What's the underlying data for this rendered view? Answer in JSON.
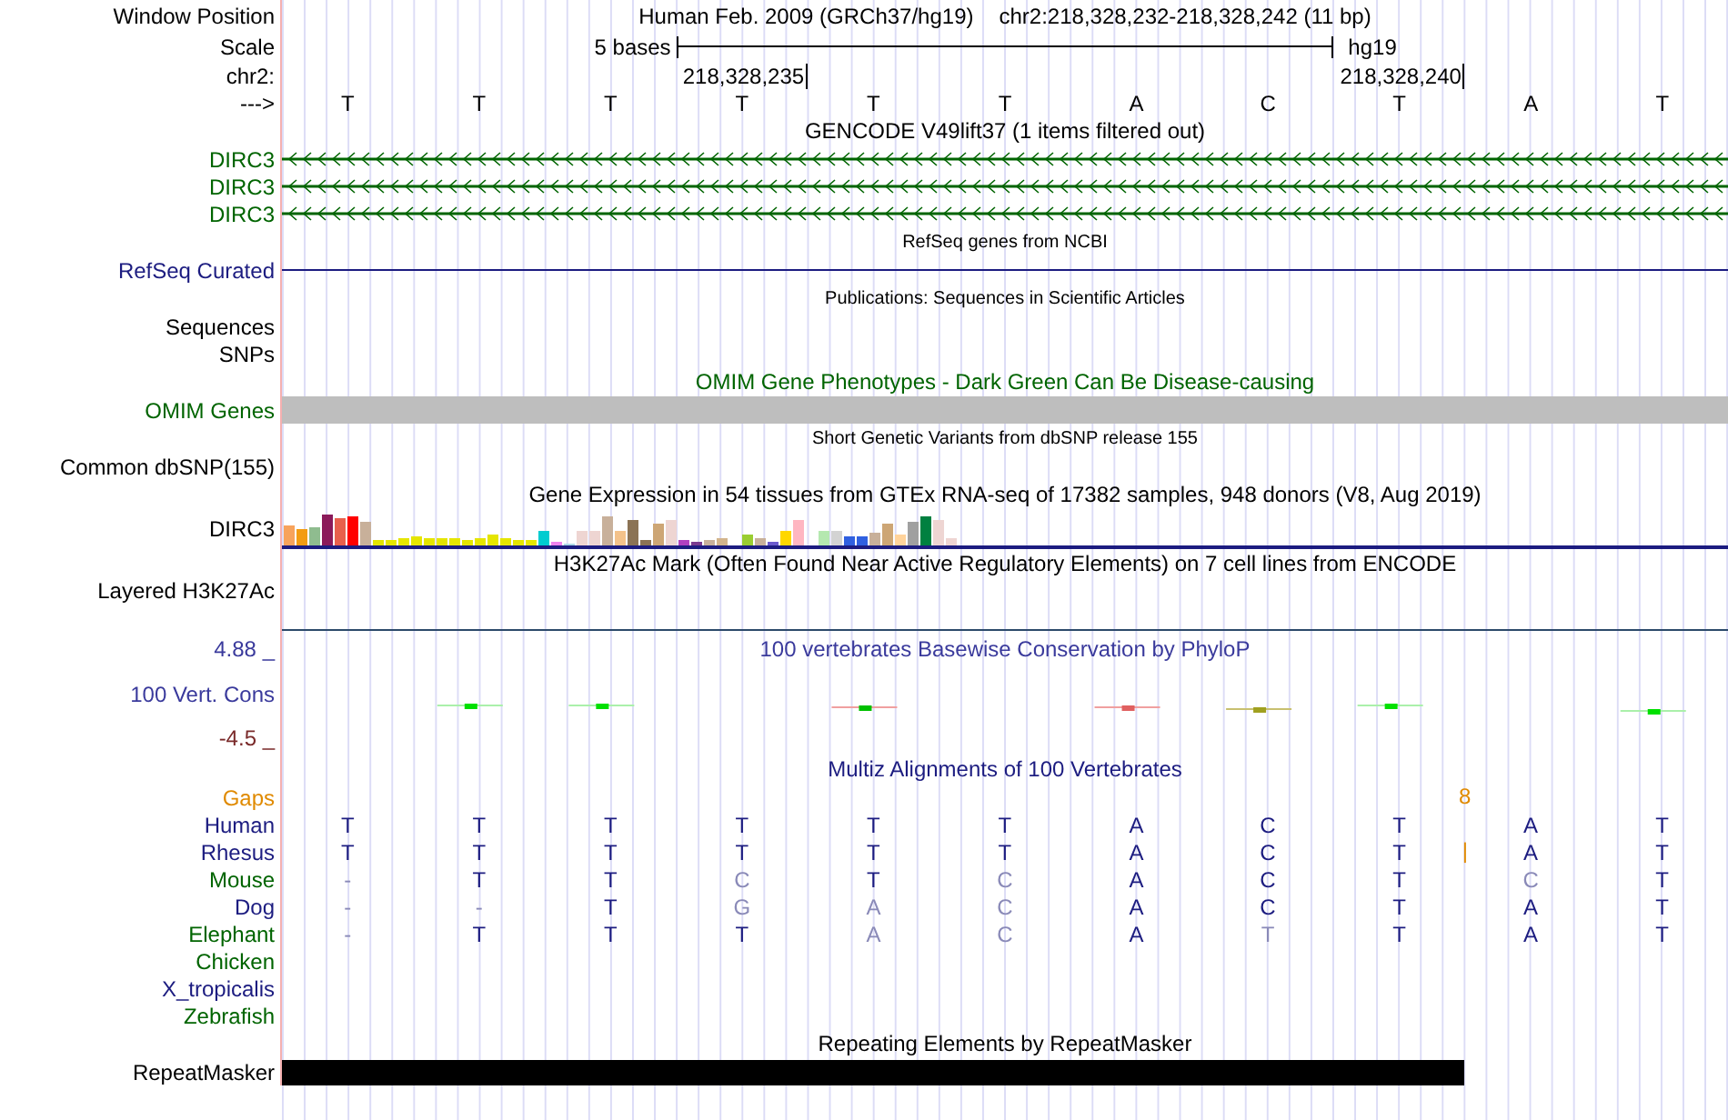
{
  "header": {
    "label": "Window Position",
    "assembly": "Human Feb. 2009 (GRCh37/hg19)",
    "position": "chr2:218,328,232-218,328,242 (11 bp)"
  },
  "scale": {
    "label": "Scale",
    "ruler_label": "5 bases",
    "assembly_label": "hg19"
  },
  "coordinates": {
    "label": "chr2:",
    "ticks": [
      "218,328,235",
      "218,328,240"
    ]
  },
  "sequence": {
    "label": "--->",
    "bases": [
      "T",
      "T",
      "T",
      "T",
      "T",
      "T",
      "A",
      "C",
      "T",
      "A",
      "T"
    ]
  },
  "tracks": [
    {
      "kind": "title",
      "text": "GENCODE V49lift37 (1 items filtered out)",
      "color": "#000000"
    },
    {
      "kind": "gene",
      "label": "DIRC3",
      "color": "#006400"
    },
    {
      "kind": "gene",
      "label": "DIRC3",
      "color": "#006400"
    },
    {
      "kind": "gene",
      "label": "DIRC3",
      "color": "#006400"
    },
    {
      "kind": "subtitle",
      "text": "RefSeq genes from NCBI",
      "color": "#000000"
    },
    {
      "kind": "line",
      "label": "RefSeq Curated",
      "color": "#1c1c80"
    },
    {
      "kind": "subtitle",
      "text": "Publications: Sequences in Scientific Articles",
      "color": "#000000"
    },
    {
      "kind": "empty",
      "label": "Sequences",
      "color": "#000000"
    },
    {
      "kind": "empty",
      "label": "SNPs",
      "color": "#000000"
    },
    {
      "kind": "title",
      "text": "OMIM Gene Phenotypes - Dark Green Can Be Disease-causing",
      "color": "#006400"
    },
    {
      "kind": "bar",
      "label": "OMIM Genes",
      "color": "#006400"
    },
    {
      "kind": "subtitle",
      "text": "Short Genetic Variants from dbSNP release 155",
      "color": "#000000"
    },
    {
      "kind": "empty",
      "label": "Common dbSNP(155)",
      "color": "#000000"
    },
    {
      "kind": "title",
      "text": "Gene Expression in 54 tissues from GTEx RNA-seq of 17382 samples, 948 donors (V8, Aug 2019)",
      "color": "#000000"
    },
    {
      "kind": "expression",
      "label": "DIRC3",
      "color": "#000000"
    },
    {
      "kind": "title",
      "text": "H3K27Ac Mark (Often Found Near Active Regulatory Elements) on 7 cell lines from ENCODE",
      "color": "#000000"
    },
    {
      "kind": "signal",
      "label": "Layered H3K27Ac",
      "color": "#000000"
    },
    {
      "kind": "conservation",
      "label": "100 Vert. Cons",
      "color": "#3a3a9c",
      "max": "4.88 _",
      "min": "-4.5 _",
      "title": "100 vertebrates Basewise Conservation by PhyloP"
    },
    {
      "kind": "title",
      "text": "Multiz Alignments of 100 Vertebrates",
      "color": "#1c1c80"
    },
    {
      "kind": "alignment",
      "label": "Gaps",
      "color": "#e08a00",
      "bases": [
        {
          "kind": "blank"
        },
        {
          "kind": "blank"
        },
        {
          "kind": "blank"
        },
        {
          "kind": "blank"
        },
        {
          "kind": "blank"
        },
        {
          "kind": "blank"
        },
        {
          "kind": "blank"
        },
        {
          "kind": "blank"
        },
        {
          "kind": "blank"
        },
        {
          "kind": "insert",
          "text": "8"
        },
        {
          "kind": "blank"
        },
        {
          "kind": "blank"
        }
      ]
    },
    {
      "kind": "alignment",
      "label": "Human",
      "color": "#1c1c80",
      "bases": [
        {
          "kind": "base",
          "text": "T",
          "match": true
        },
        {
          "kind": "base",
          "text": "T",
          "match": true
        },
        {
          "kind": "base",
          "text": "T",
          "match": true
        },
        {
          "kind": "base",
          "text": "T",
          "match": true
        },
        {
          "kind": "base",
          "text": "T",
          "match": true
        },
        {
          "kind": "base",
          "text": "T",
          "match": true
        },
        {
          "kind": "base",
          "text": "A",
          "match": true
        },
        {
          "kind": "base",
          "text": "C",
          "match": true
        },
        {
          "kind": "base",
          "text": "T",
          "match": true
        },
        {
          "kind": "base",
          "text": "A",
          "match": true
        },
        {
          "kind": "base",
          "text": "T",
          "match": true
        }
      ]
    },
    {
      "kind": "alignment",
      "label": "Rhesus",
      "color": "#1c1c80",
      "bases": [
        {
          "kind": "base",
          "text": "T",
          "match": true
        },
        {
          "kind": "base",
          "text": "T",
          "match": true
        },
        {
          "kind": "base",
          "text": "T",
          "match": true
        },
        {
          "kind": "base",
          "text": "T",
          "match": true
        },
        {
          "kind": "base",
          "text": "T",
          "match": true
        },
        {
          "kind": "base",
          "text": "T",
          "match": true
        },
        {
          "kind": "base",
          "text": "A",
          "match": true
        },
        {
          "kind": "base",
          "text": "C",
          "match": true
        },
        {
          "kind": "base",
          "text": "T",
          "match": true
        },
        {
          "kind": "insert",
          "text": "|"
        },
        {
          "kind": "base",
          "text": "A",
          "match": true
        },
        {
          "kind": "base",
          "text": "T",
          "match": true
        }
      ]
    },
    {
      "kind": "alignment",
      "label": "Mouse",
      "color": "#006400",
      "bases": [
        {
          "kind": "base",
          "text": "-",
          "match": false
        },
        {
          "kind": "base",
          "text": "T",
          "match": true
        },
        {
          "kind": "base",
          "text": "T",
          "match": true
        },
        {
          "kind": "base",
          "text": "C",
          "match": false
        },
        {
          "kind": "base",
          "text": "T",
          "match": true
        },
        {
          "kind": "base",
          "text": "C",
          "match": false
        },
        {
          "kind": "base",
          "text": "A",
          "match": true
        },
        {
          "kind": "base",
          "text": "C",
          "match": true
        },
        {
          "kind": "base",
          "text": "T",
          "match": true
        },
        {
          "kind": "base",
          "text": "C",
          "match": false
        },
        {
          "kind": "base",
          "text": "T",
          "match": true
        }
      ]
    },
    {
      "kind": "alignment",
      "label": "Dog",
      "color": "#1c1c80",
      "bases": [
        {
          "kind": "base",
          "text": "-",
          "match": false
        },
        {
          "kind": "base",
          "text": "-",
          "match": false
        },
        {
          "kind": "base",
          "text": "T",
          "match": true
        },
        {
          "kind": "base",
          "text": "G",
          "match": false
        },
        {
          "kind": "base",
          "text": "A",
          "match": false
        },
        {
          "kind": "base",
          "text": "C",
          "match": false
        },
        {
          "kind": "base",
          "text": "A",
          "match": true
        },
        {
          "kind": "base",
          "text": "C",
          "match": true
        },
        {
          "kind": "base",
          "text": "T",
          "match": true
        },
        {
          "kind": "base",
          "text": "A",
          "match": true
        },
        {
          "kind": "base",
          "text": "T",
          "match": true
        }
      ]
    },
    {
      "kind": "alignment",
      "label": "Elephant",
      "color": "#006400",
      "bases": [
        {
          "kind": "base",
          "text": "-",
          "match": false
        },
        {
          "kind": "base",
          "text": "T",
          "match": true
        },
        {
          "kind": "base",
          "text": "T",
          "match": true
        },
        {
          "kind": "base",
          "text": "T",
          "match": true
        },
        {
          "kind": "base",
          "text": "A",
          "match": false
        },
        {
          "kind": "base",
          "text": "C",
          "match": false
        },
        {
          "kind": "base",
          "text": "A",
          "match": true
        },
        {
          "kind": "base",
          "text": "T",
          "match": false
        },
        {
          "kind": "base",
          "text": "T",
          "match": true
        },
        {
          "kind": "base",
          "text": "A",
          "match": true
        },
        {
          "kind": "base",
          "text": "T",
          "match": true
        }
      ]
    },
    {
      "kind": "alignment",
      "label": "Chicken",
      "color": "#006400"
    },
    {
      "kind": "alignment",
      "label": "X_tropicalis",
      "color": "#1c1c80"
    },
    {
      "kind": "alignment",
      "label": "Zebrafish",
      "color": "#006400"
    },
    {
      "kind": "title",
      "text": "Repeating Elements by RepeatMasker",
      "color": "#000000"
    },
    {
      "kind": "repeat",
      "label": "RepeatMasker",
      "color": "#000000",
      "level": 0.818
    }
  ]
}
